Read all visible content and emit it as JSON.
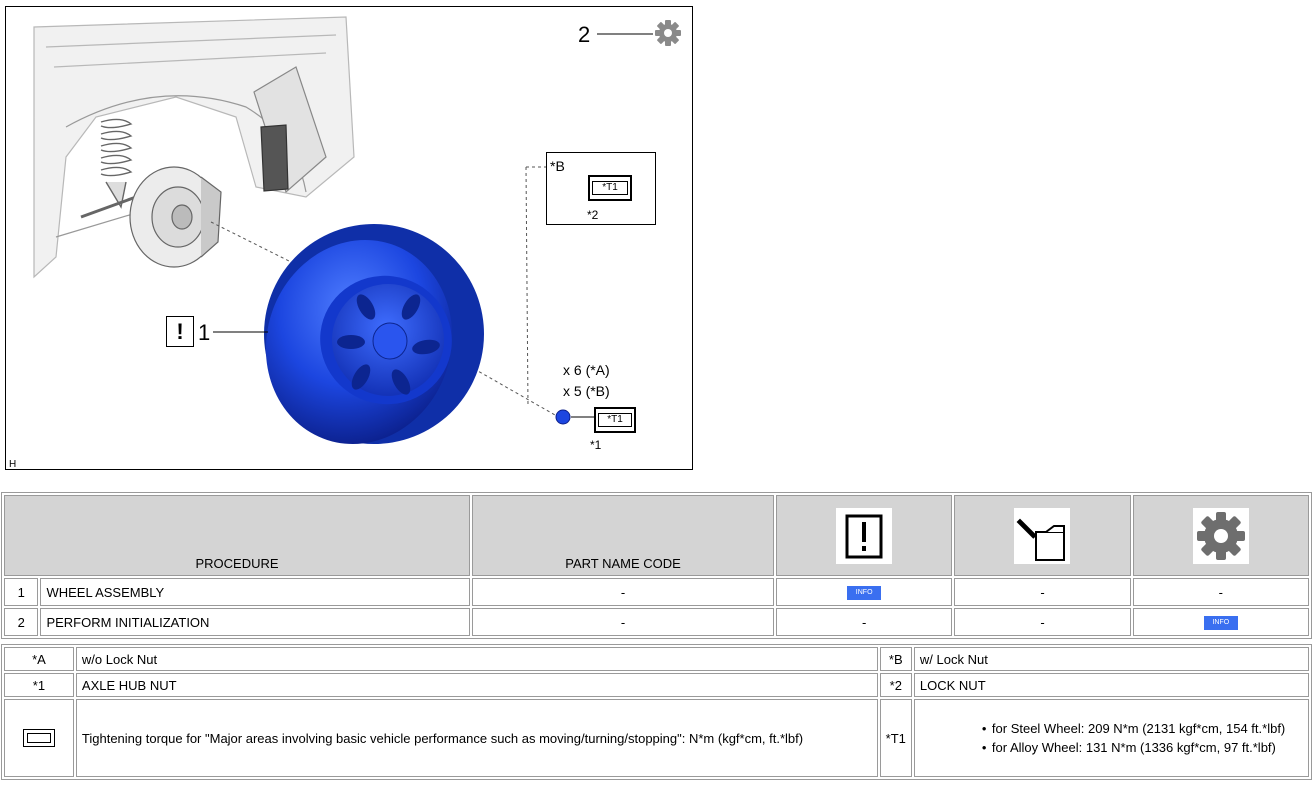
{
  "figure": {
    "callout_2": "2",
    "callout_1": "1",
    "caution_symbol": "!",
    "nut_b_label": "*B",
    "nut_b_part": "*2",
    "nut_a_part": "*1",
    "torque_tag": "*T1",
    "qty_a": "x 6  (*A)",
    "qty_b": "x 5  (*B)",
    "corner_mark": "H",
    "wheel_color": "#1c46e0",
    "icons": [
      "gear-icon",
      "caution-icon"
    ]
  },
  "procedure_table": {
    "headers": {
      "procedure": "PROCEDURE",
      "part_name_code": "PART NAME CODE",
      "col3_icon": "caution-icon",
      "col4_icon": "oil-can-icon",
      "col5_icon": "gear-icon"
    },
    "rows": [
      {
        "num": "1",
        "procedure": "WHEEL ASSEMBLY",
        "code": "-",
        "col3": "INFO",
        "col4": "-",
        "col5": "-"
      },
      {
        "num": "2",
        "procedure": "PERFORM INITIALIZATION",
        "code": "-",
        "col3": "-",
        "col4": "-",
        "col5": "INFO"
      }
    ],
    "info_color": "#3a6ff0"
  },
  "legend_table": {
    "rows": [
      {
        "k1": "*A",
        "v1": "w/o Lock Nut",
        "k2": "*B",
        "v2": "w/ Lock Nut"
      },
      {
        "k1": "*1",
        "v1": "AXLE HUB NUT",
        "k2": "*2",
        "v2": "LOCK NUT"
      }
    ],
    "torque_desc": "Tightening torque for \"Major areas involving basic vehicle performance such as moving/turning/stopping\": N*m (kgf*cm, ft.*lbf)",
    "torque_key": "*T1",
    "torque_items": [
      "for Steel Wheel: 209 N*m (2131 kgf*cm, 154 ft.*lbf)",
      "for Alloy Wheel: 131 N*m (1336 kgf*cm, 97 ft.*lbf)"
    ]
  }
}
